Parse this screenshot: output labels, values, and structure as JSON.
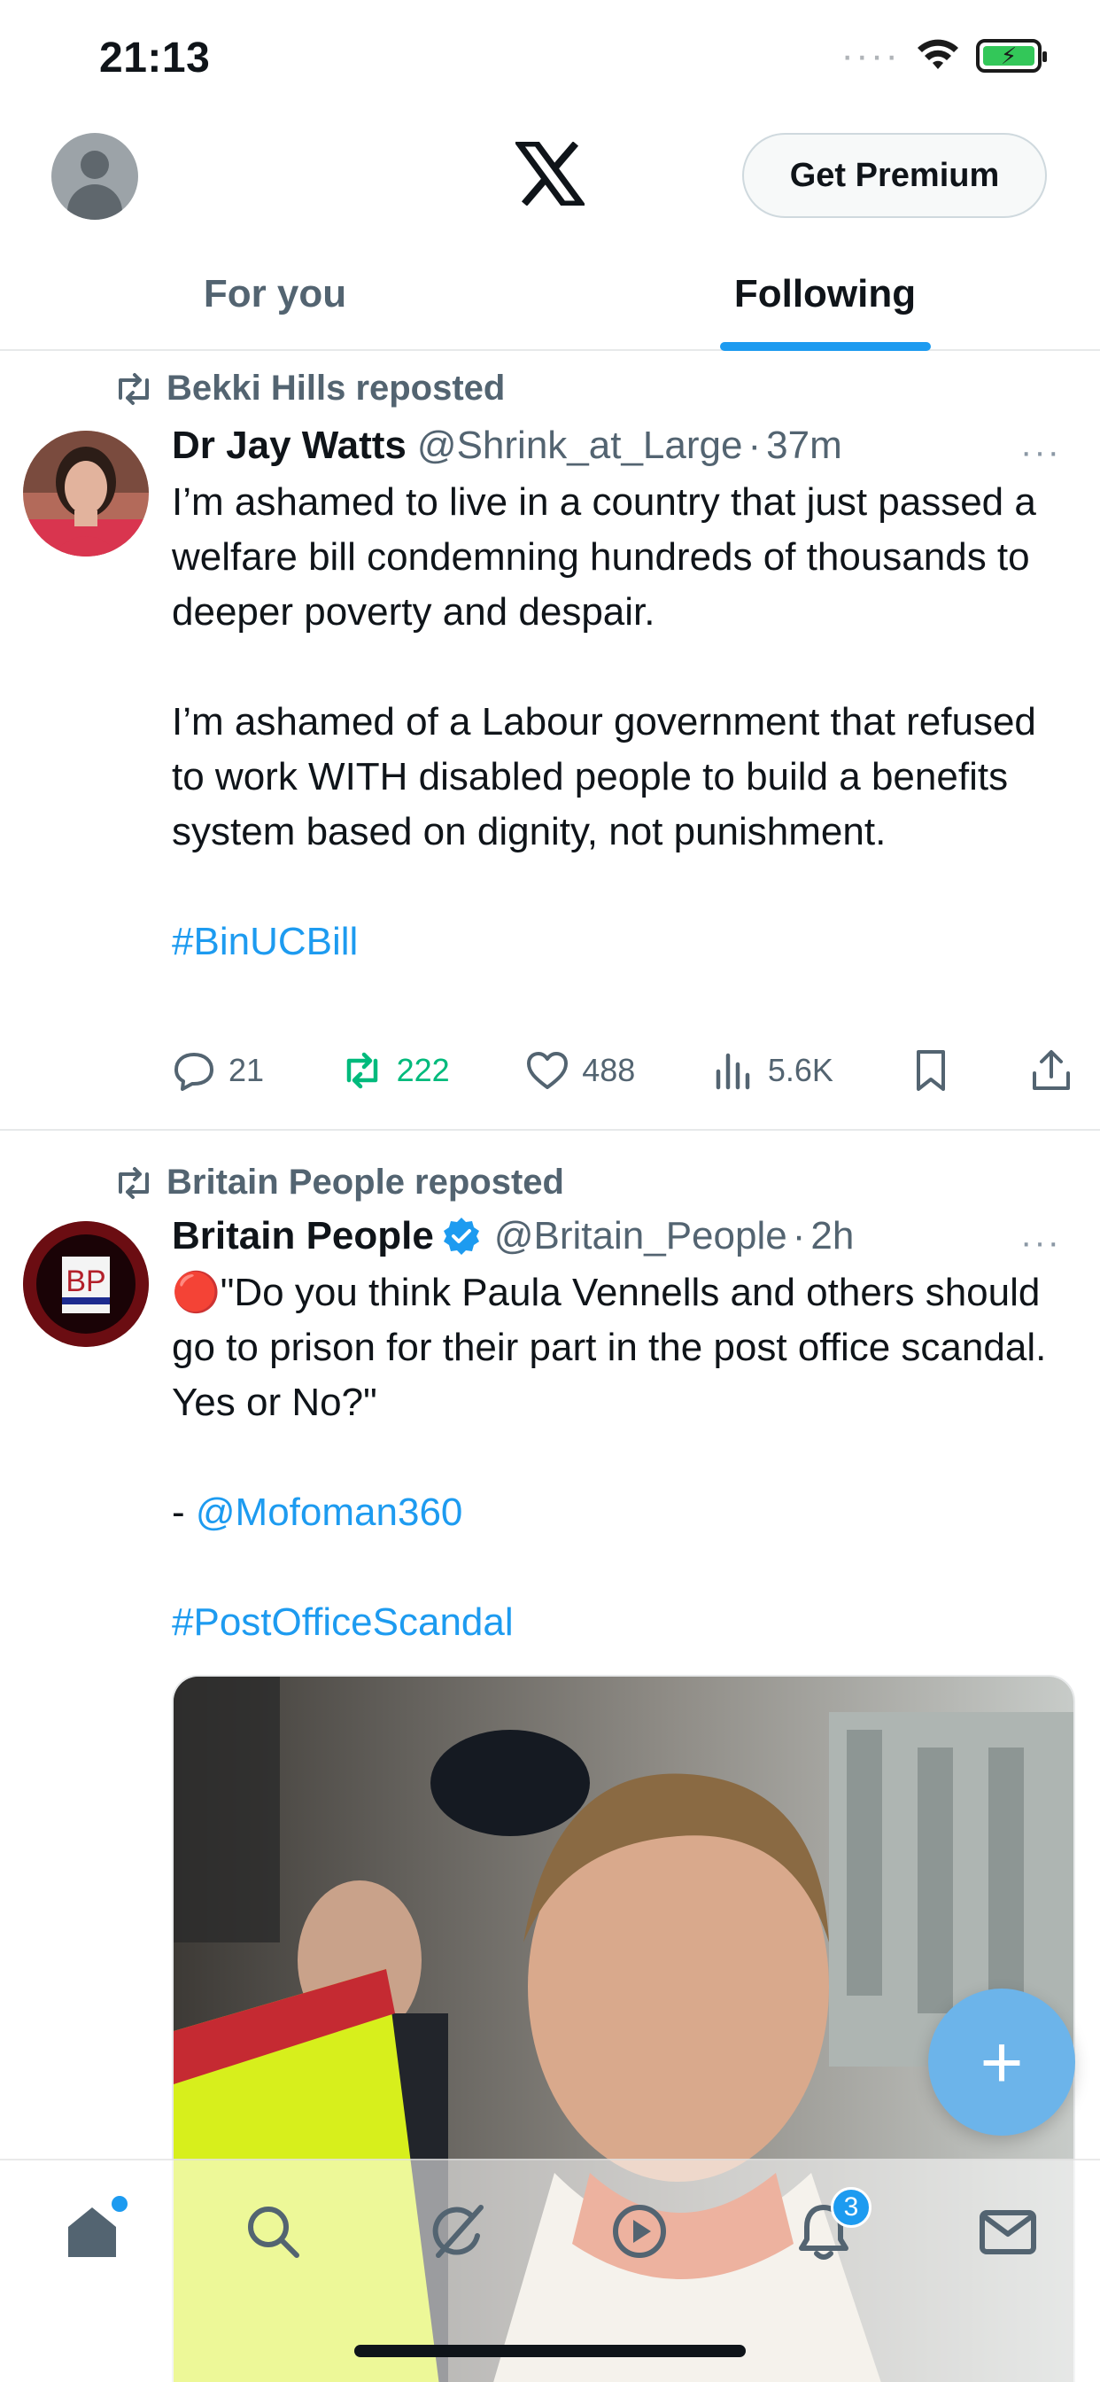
{
  "status_bar": {
    "time": "21:13",
    "signal_icon": "signal-dots-icon",
    "wifi_icon": "wifi-icon",
    "battery_icon": "battery-charging-icon",
    "battery_color": "#33c759"
  },
  "header": {
    "profile_icon": "profile-avatar-icon",
    "logo_icon": "x-logo-icon",
    "premium_label": "Get Premium"
  },
  "tabs": [
    {
      "label": "For you",
      "active": false
    },
    {
      "label": "Following",
      "active": true
    }
  ],
  "tweets": [
    {
      "repost_by": "Bekki Hills reposted",
      "name": "Dr Jay Watts",
      "handle": "@Shrink_at_Large",
      "separator": "·",
      "time": "37m",
      "more": "···",
      "text_p1": "I’m ashamed to live in a country that just passed a welfare bill condemning hundreds of thousands to deeper poverty and despair.",
      "text_p2": "I’m ashamed of a Labour government that refused to work WITH disabled people to build a benefits system based on dignity, not punishment.",
      "hashtag": "#BinUCBill",
      "replies": "21",
      "reposts": "222",
      "likes": "488",
      "views": "5.6K"
    },
    {
      "repost_by": "Britain People reposted",
      "name": "Britain People",
      "handle": "@Britain_People",
      "separator": "·",
      "time": "2h",
      "more": "···",
      "avatar_text": "BP",
      "text_p1": "🔴\"Do you think Paula Vennells and others should go to prison for their part in the post office scandal.  Yes or No?\"",
      "mention_prefix": "- ",
      "mention": "@Mofoman360",
      "hashtag": "#PostOfficeScandal",
      "media_icon": "photo-media"
    }
  ],
  "fab": {
    "label": "+",
    "icon": "compose-plus-icon"
  },
  "bottom_nav": [
    {
      "icon": "home-icon",
      "badge": ""
    },
    {
      "icon": "search-icon",
      "badge": ""
    },
    {
      "icon": "grok-icon",
      "badge": ""
    },
    {
      "icon": "video-play-icon",
      "badge": ""
    },
    {
      "icon": "notifications-bell-icon",
      "badge": "3"
    },
    {
      "icon": "messages-mail-icon",
      "badge": ""
    }
  ],
  "colors": {
    "accent": "#1d9bf0",
    "repost_green": "#00ba7c",
    "muted": "#536471"
  }
}
